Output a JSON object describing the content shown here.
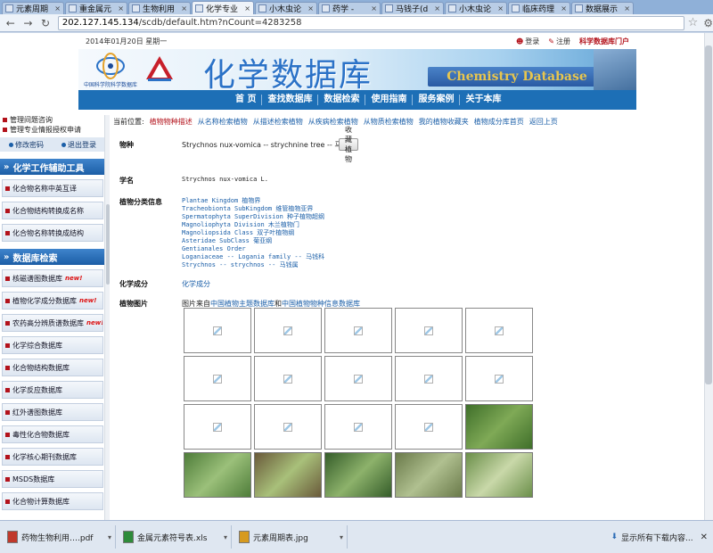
{
  "browser": {
    "tabs": [
      {
        "label": "元素周期"
      },
      {
        "label": "重金属元"
      },
      {
        "label": "生物利用"
      },
      {
        "label": "化学专业",
        "active": true
      },
      {
        "label": "小木虫论"
      },
      {
        "label": "药学 - "
      },
      {
        "label": "马钱子(d"
      },
      {
        "label": "小木虫论"
      },
      {
        "label": "临床药理"
      },
      {
        "label": "数据展示"
      }
    ],
    "url_host": "202.127.145.134",
    "url_path": "/scdb/default.htm?nCount=4283258"
  },
  "header": {
    "date": "2014年01月20日 星期一",
    "login": "登录",
    "register": "注册",
    "portal": "科学数据库门户",
    "logo_text": "中国科学院科学数据库",
    "title": "化学数据库",
    "title_en": "Chemistry Database"
  },
  "mainnav": [
    "首  页",
    "查找数据库",
    "数据检索",
    "使用指南",
    "服务案例",
    "关于本库"
  ],
  "sidebar": {
    "admin_links": [
      "管理间题咨询",
      "管理专业情报授权申请"
    ],
    "buttons": [
      "修改密码",
      "退出登录"
    ],
    "section1": "化学工作辅助工具",
    "tools": [
      "化合物名称中英互译",
      "化合物结构转换成名称",
      "化合物名称转换成结构"
    ],
    "section2": "数据库检索",
    "dbs": [
      {
        "label": "核磁谱图数据库",
        "new": "new!"
      },
      {
        "label": "植物化学成分数据库",
        "new": "new!"
      },
      {
        "label": "农药高分辨质谱数据库",
        "new": "new!"
      },
      {
        "label": "化学综合数据库"
      },
      {
        "label": "化合物结构数据库"
      },
      {
        "label": "化学反应数据库"
      },
      {
        "label": "红外谱图数据库"
      },
      {
        "label": "毒性化合物数据库"
      },
      {
        "label": "化学核心期刊数据库"
      },
      {
        "label": "MSDS数据库"
      },
      {
        "label": "化合物计算数据库"
      }
    ]
  },
  "content": {
    "crumb_prefix": "当前位置:",
    "crumb_current": "植物物种描述",
    "crumb_links": [
      "从名称检索植物",
      "从描述检索植物",
      "从疾病检索植物",
      "从物质检索植物",
      "我的植物收藏夹",
      "植物成分库首页",
      "返回上页"
    ],
    "species_label": "物种",
    "species_value": "Strychnos nux-vomica -- strychnine tree -- 马钱子",
    "collect_btn": "收藏植物",
    "sci_label": "学名",
    "sci_value": "Strychnos nux-vomica L.",
    "tax_label": "植物分类信息",
    "taxonomy": [
      "Plantae Kingdom 植物界",
      "  Tracheobionta SubKingdom 维管植物亚界",
      "    Spermatophyta SuperDivision 种子植物超纲",
      "      Magnoliophyta Division 木兰植物门",
      "        Magnoliopsida Class 双子叶植物纲",
      "          Asteridae SubClass 菊亚纲",
      "            Gentianales Order",
      "              Loganiaceae -- Logania family -- 马钱科",
      "                Strychnos -- strychnos -- 马钱属"
    ],
    "comp_label": "化学成分",
    "comp_link": "化学成分",
    "img_label": "植物图片",
    "img_note_prefix": "图片来自",
    "img_note_link1": "中国植物主题数据库",
    "img_note_mid": "和",
    "img_note_link2": "中国植物物种信息数据库"
  },
  "downloads": [
    {
      "name": "药物生物利用….pdf",
      "icon": "pdf-icon",
      "color": "#c0392b"
    },
    {
      "name": "金属元素符号表.xls",
      "icon": "excel-icon",
      "color": "#2e8b3a"
    },
    {
      "name": "元素周期表.jpg",
      "icon": "image-icon",
      "color": "#d69a1f"
    }
  ],
  "download_show_all": "显示所有下载内容..."
}
